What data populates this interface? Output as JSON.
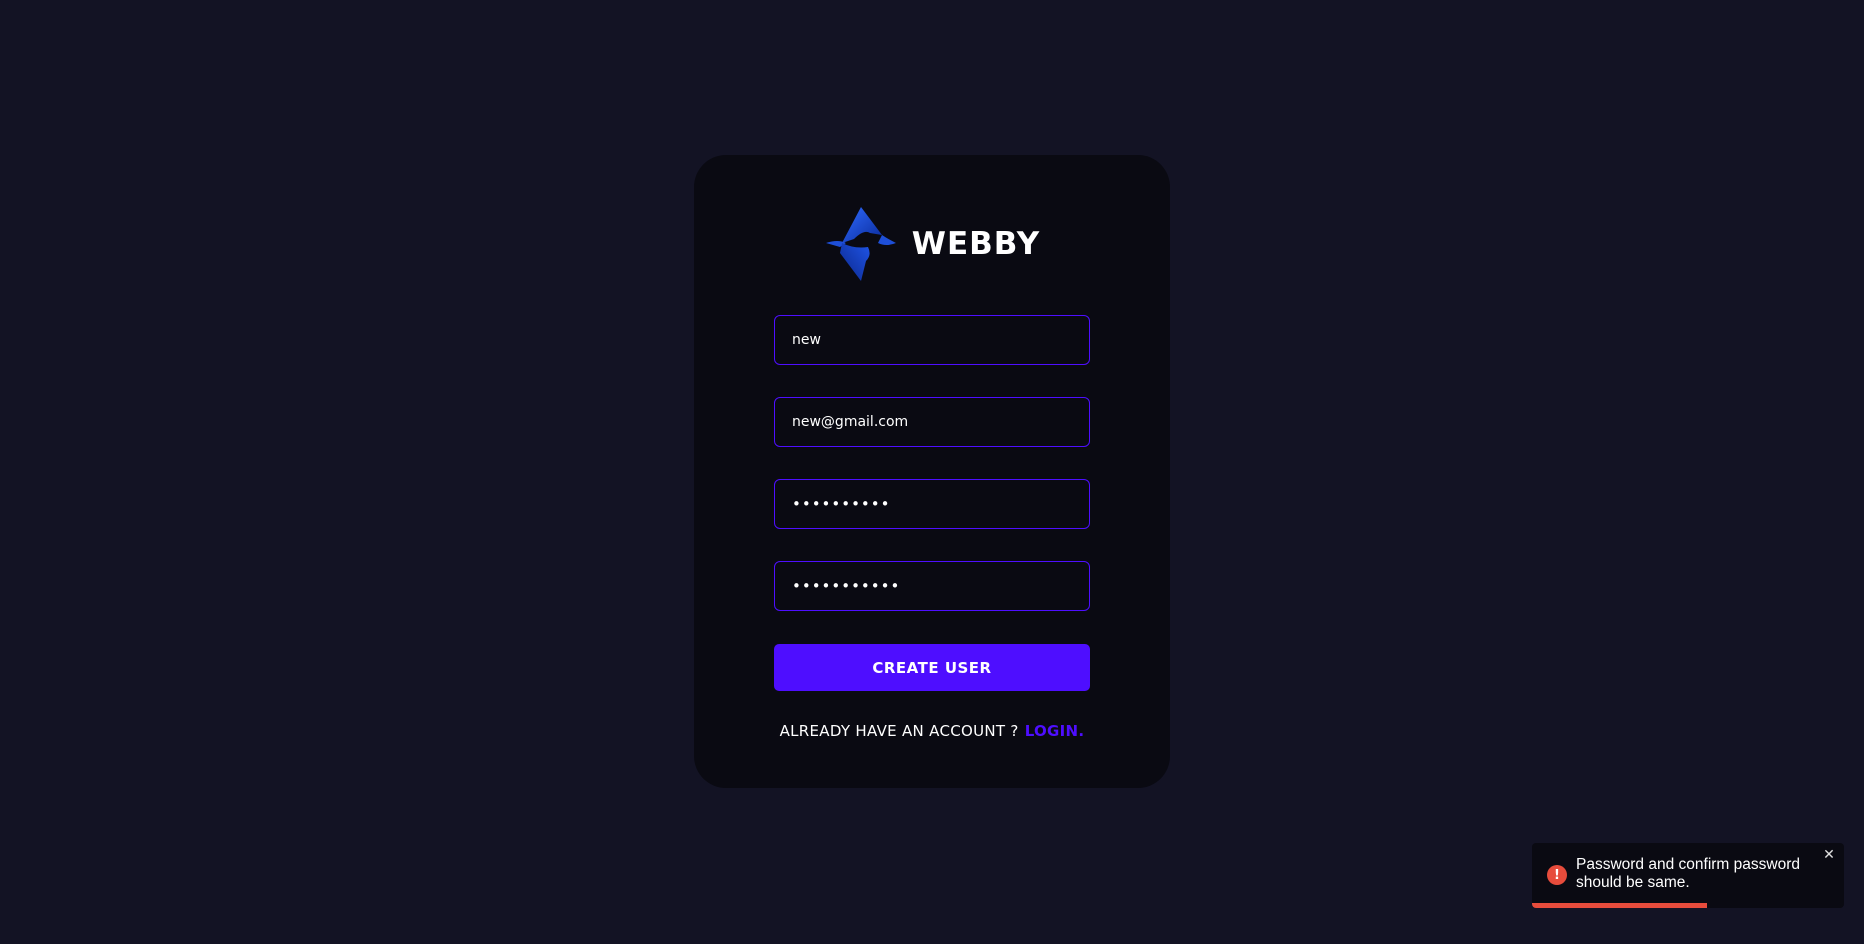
{
  "brand": {
    "name": "WEBBY",
    "logo_icon": "webby-diamond-logo"
  },
  "form": {
    "username_value": "new",
    "email_value": "new@gmail.com",
    "password_value": "••••••••••",
    "confirm_password_value": "•••••••••••",
    "submit_label": "CREATE USER",
    "footer_text": "ALREADY HAVE AN ACCOUNT ?",
    "footer_link": "LOGIN."
  },
  "toast": {
    "type": "error",
    "icon": "error-icon",
    "message": "Password and confirm password should be same.",
    "close_icon": "close-icon",
    "progress_remaining": 0.56
  },
  "colors": {
    "background": "#131324",
    "card": "#0a0a12",
    "accent": "#4e0eff",
    "error": "#e74c3c"
  }
}
